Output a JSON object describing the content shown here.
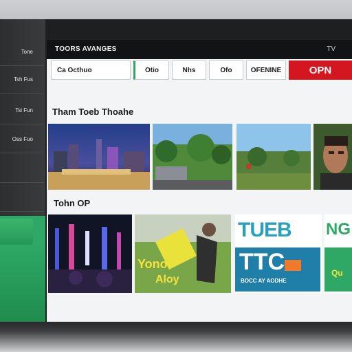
{
  "sidebar": {
    "items": [
      {
        "label": "Tone"
      },
      {
        "label": "Tsh Fus"
      },
      {
        "label": "Tsi Fun"
      },
      {
        "label": "Oss Fuo"
      }
    ]
  },
  "topbar": {
    "title": "TOORS AVANGES",
    "icon": "TV"
  },
  "tabs": [
    {
      "label": "Ca  Octhuo"
    },
    {
      "label": "Otio"
    },
    {
      "label": "Nhs"
    },
    {
      "label": "Ofo"
    },
    {
      "label": "OFENINE"
    },
    {
      "label": "OPN"
    }
  ],
  "sections": {
    "first_title": "Tham Toeb Thoahe",
    "second_title": "Tohn OP"
  },
  "tiles": {
    "row2_text_1": "Yono",
    "row2_text_2": "Aloy",
    "logo_top": "TUEB",
    "logo_top_right": "NG",
    "logo_main": "TTC",
    "logo_small": "BOCC AY AODHE",
    "logo_right": "Qu"
  },
  "colors": {
    "accent_green": "#2ea864",
    "accent_red": "#d3161f",
    "topbar_bg": "#121314",
    "panel_bg": "#f3f4f5",
    "logo_blue": "#1f7fa8"
  }
}
